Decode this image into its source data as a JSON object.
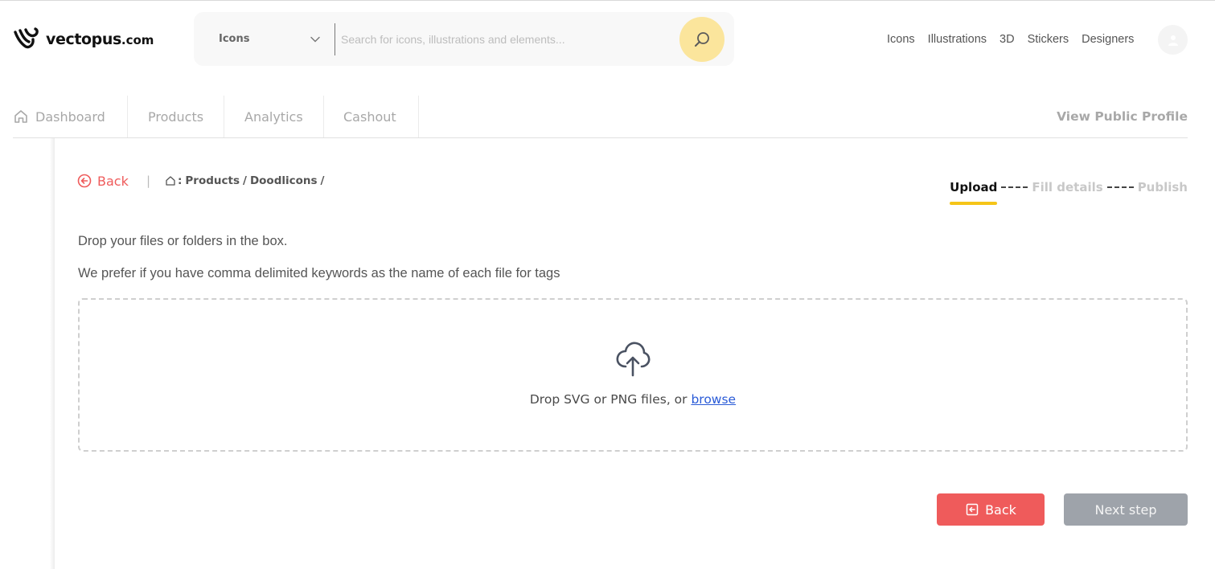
{
  "brand": {
    "name": "vectopus",
    "domain": ".com"
  },
  "search": {
    "type_label": "Icons",
    "placeholder": "Search for icons, illustrations and elements..."
  },
  "topnav": {
    "items": [
      "Icons",
      "Illustrations",
      "3D",
      "Stickers",
      "Designers"
    ]
  },
  "tabs": {
    "items": [
      "Dashboard",
      "Products",
      "Analytics",
      "Cashout"
    ],
    "view_profile": "View Public Profile"
  },
  "breadcrumb": {
    "back": "Back",
    "separator": "|",
    "home_prefix": ":",
    "items": [
      "Products",
      "/",
      "Doodlicons",
      "/"
    ]
  },
  "steps": {
    "items": [
      "Upload",
      "Fill details",
      "Publish"
    ],
    "active_index": 0
  },
  "instructions": {
    "line1": "Drop your files or folders in the box.",
    "line2": "We prefer if you have comma delimited keywords as the name of each file for tags"
  },
  "dropzone": {
    "text": "Drop SVG or PNG files, or ",
    "browse": "browse"
  },
  "buttons": {
    "back": "Back",
    "next": "Next step"
  },
  "colors": {
    "accent_red": "#ef5b5b",
    "search_button": "#fbe59c",
    "step_underline": "#f5c518",
    "link_blue": "#2a5bd7",
    "disabled_gray": "#9ea3aa"
  }
}
